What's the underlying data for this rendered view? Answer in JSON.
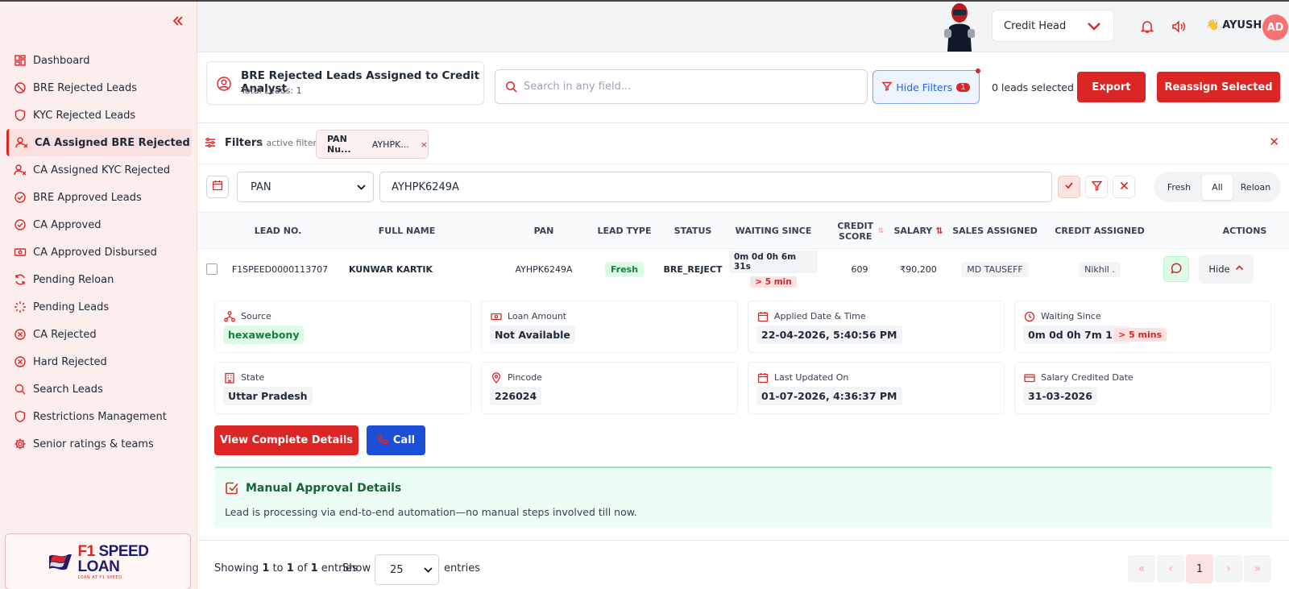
{
  "sidebar": {
    "collapse_icon": "double-chevron-left-icon",
    "items": [
      {
        "label": "Dashboard",
        "icon": "dashboard-icon"
      },
      {
        "label": "BRE Rejected Leads",
        "icon": "ban-icon"
      },
      {
        "label": "KYC Rejected Leads",
        "icon": "shield-icon"
      },
      {
        "label": "CA Assigned BRE Rejected",
        "icon": "user-x-icon",
        "active": true
      },
      {
        "label": "CA Assigned KYC Rejected",
        "icon": "user-x-icon"
      },
      {
        "label": "BRE Approved Leads",
        "icon": "check-circle-icon"
      },
      {
        "label": "CA Approved",
        "icon": "check-circle-icon"
      },
      {
        "label": "CA Approved Disbursed",
        "icon": "banknote-icon"
      },
      {
        "label": "Pending Reloan",
        "icon": "refresh-icon"
      },
      {
        "label": "Pending Leads",
        "icon": "loader-icon"
      },
      {
        "label": "CA Rejected",
        "icon": "x-circle-icon"
      },
      {
        "label": "Hard Rejected",
        "icon": "x-circle-icon"
      },
      {
        "label": "Search Leads",
        "icon": "search-icon"
      },
      {
        "label": "Restrictions Management",
        "icon": "shield-icon"
      },
      {
        "label": "Senior ratings & teams",
        "icon": "gear-icon"
      }
    ],
    "logo": {
      "brand_prefix": "F1",
      "brand_rest": " SPEED",
      "brand_line2": "LOAN",
      "tagline": "LOAN AT F1 SPEED."
    }
  },
  "topbar": {
    "role": "Credit Head",
    "user_emoji": "👋",
    "user_name": "AYUSH",
    "user_initials": "AD"
  },
  "header": {
    "title": "BRE Rejected Leads Assigned to Credit Analyst",
    "subtitle": "Total Leads: 1",
    "search_placeholder": "Search in any field...",
    "hide_filters_label": "Hide Filters",
    "hide_filters_badge": "1",
    "selected_text": "0 leads selected",
    "export_label": "Export",
    "reassign_label": "Reassign Selected"
  },
  "filters": {
    "label": "Filters",
    "count_text": "1 active filter",
    "chip_field": "PAN Nu...",
    "chip_value": "AYHPK...",
    "chip_remove": "×",
    "close": "✕",
    "field": "PAN",
    "value": "AYHPK6249A",
    "segments": [
      "Fresh",
      "All",
      "Reloan"
    ],
    "active_segment": "All"
  },
  "table": {
    "headers": {
      "lead_no": "LEAD NO.",
      "full_name": "FULL NAME",
      "pan": "PAN",
      "lead_type": "LEAD TYPE",
      "status": "STATUS",
      "waiting": "WAITING SINCE",
      "credit_score": "CREDIT SCORE",
      "salary": "SALARY",
      "sales": "SALES ASSIGNED",
      "credit": "CREDIT ASSIGNED",
      "actions": "ACTIONS"
    },
    "row": {
      "lead_no": "F1SPEED0000113707",
      "full_name": "KUNWAR KARTIK",
      "pan": "AYHPK6249A",
      "lead_type": "Fresh",
      "status": "BRE_REJECT",
      "waiting": "0m 0d 0h 6m 31s",
      "waiting_tag": "> 5 min",
      "credit_score": "609",
      "salary": "₹90,200",
      "sales": "MD TAUSEFF",
      "credit": "Nikhil .",
      "hide_label": "Hide"
    }
  },
  "details": {
    "source_label": "Source",
    "source": "hexawebony",
    "loan_label": "Loan Amount",
    "loan": "Not Available",
    "applied_label": "Applied Date & Time",
    "applied": "22-04-2026, 5:40:56 PM",
    "waiting_label": "Waiting Since",
    "waiting": "0m 0d 0h 7m 11s",
    "waiting_tag": "> 5 mins",
    "state_label": "State",
    "state": "Uttar Pradesh",
    "pincode_label": "Pincode",
    "pincode": "226024",
    "updated_label": "Last Updated On",
    "updated": "01-07-2026, 4:36:37 PM",
    "salary_date_label": "Salary Credited Date",
    "salary_date": "31-03-2026",
    "view_label": "View Complete Details",
    "call_label": "Call"
  },
  "approval": {
    "title": "Manual Approval Details",
    "text": "Lead is processing via end-to-end automation—no manual steps involved till now."
  },
  "footer": {
    "showing_prefix": "Showing",
    "from": "1",
    "to_word": "to",
    "to": "1",
    "of_word": "of",
    "total": "1",
    "entries_word": "entries",
    "show_label": "Show",
    "page_size": "25",
    "entries_label": "entries",
    "current_page": "1"
  },
  "colors": {
    "accent": "#dc2626",
    "sidebar_bg": "#fdeeee",
    "call_blue": "#1d4ed8",
    "success": "#15803d"
  }
}
